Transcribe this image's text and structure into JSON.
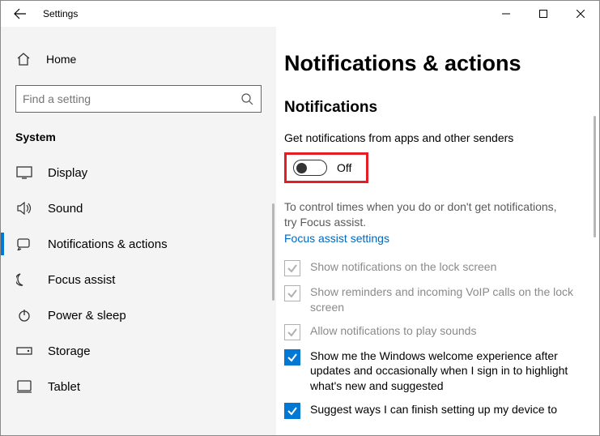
{
  "titlebar": {
    "title": "Settings"
  },
  "home": {
    "label": "Home"
  },
  "search": {
    "placeholder": "Find a setting"
  },
  "category": "System",
  "nav": {
    "items": [
      {
        "label": "Display"
      },
      {
        "label": "Sound"
      },
      {
        "label": "Notifications & actions"
      },
      {
        "label": "Focus assist"
      },
      {
        "label": "Power & sleep"
      },
      {
        "label": "Storage"
      },
      {
        "label": "Tablet"
      }
    ]
  },
  "page": {
    "title": "Notifications & actions",
    "section": "Notifications",
    "get_notifications_label": "Get notifications from apps and other senders",
    "toggle_state": "Off",
    "help_text": "To control times when you do or don't get notifications, try Focus assist.",
    "focus_link": "Focus assist settings",
    "checks": [
      {
        "label": "Show notifications on the lock screen"
      },
      {
        "label": "Show reminders and incoming VoIP calls on the lock screen"
      },
      {
        "label": "Allow notifications to play sounds"
      },
      {
        "label": "Show me the Windows welcome experience after updates and occasionally when I sign in to highlight what's new and suggested"
      },
      {
        "label": "Suggest ways I can finish setting up my device to"
      }
    ]
  }
}
